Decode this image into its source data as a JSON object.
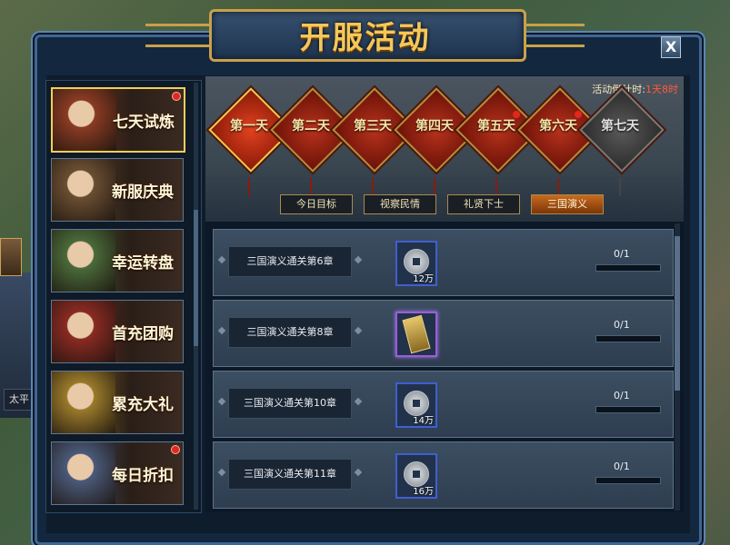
{
  "title": "开服活动",
  "close_label": "X",
  "world": {
    "side_label": "太平"
  },
  "menu": [
    {
      "label": "七天试炼",
      "active": true,
      "dot": true,
      "color": "#8a3b23"
    },
    {
      "label": "新服庆典",
      "active": false,
      "dot": false,
      "color": "#6a4e32"
    },
    {
      "label": "幸运转盘",
      "active": false,
      "dot": false,
      "color": "#4a6a3a"
    },
    {
      "label": "首充团购",
      "active": false,
      "dot": false,
      "color": "#8a2a22"
    },
    {
      "label": "累充大礼",
      "active": false,
      "dot": false,
      "color": "#9a7a2a"
    },
    {
      "label": "每日折扣",
      "active": false,
      "dot": true,
      "color": "#4a5a7a"
    }
  ],
  "countdown": {
    "label": "活动倒计时:",
    "value": "1天8时"
  },
  "days": [
    {
      "label": "第一天",
      "state": "active",
      "dot": false
    },
    {
      "label": "第二天",
      "state": "red",
      "dot": false
    },
    {
      "label": "第三天",
      "state": "red",
      "dot": false
    },
    {
      "label": "第四天",
      "state": "red",
      "dot": false
    },
    {
      "label": "第五天",
      "state": "red",
      "dot": true
    },
    {
      "label": "第六天",
      "state": "red",
      "dot": true
    },
    {
      "label": "第七天",
      "state": "grey",
      "dot": false
    }
  ],
  "tabs": [
    {
      "label": "今日目标",
      "active": false
    },
    {
      "label": "视察民情",
      "active": false
    },
    {
      "label": "礼贤下士",
      "active": false
    },
    {
      "label": "三国演义",
      "active": true
    }
  ],
  "tasks": [
    {
      "name": "三国演义通关第6章",
      "reward_type": "coin",
      "reward_count": "12万",
      "progress": "0/1"
    },
    {
      "name": "三国演义通关第8章",
      "reward_type": "token",
      "reward_count": "",
      "progress": "0/1"
    },
    {
      "name": "三国演义通关第10章",
      "reward_type": "coin",
      "reward_count": "14万",
      "progress": "0/1"
    },
    {
      "name": "三国演义通关第11章",
      "reward_type": "coin",
      "reward_count": "16万",
      "progress": "0/1"
    }
  ]
}
